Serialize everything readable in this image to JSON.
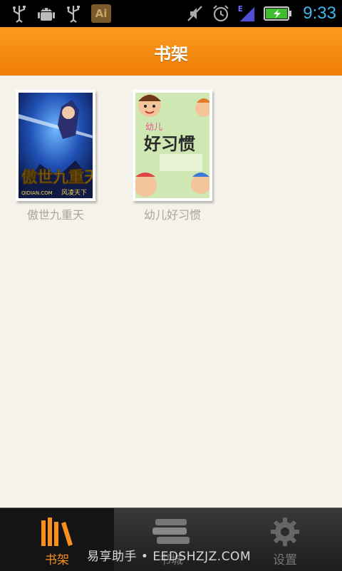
{
  "status_bar": {
    "icons_left": [
      "usb-icon",
      "android-debug-icon",
      "usb-icon",
      "ai-app-icon"
    ],
    "ai_badge": "Ai",
    "icons_right": [
      "mute-icon",
      "alarm-icon",
      "signal-e-icon",
      "battery-charging-icon"
    ],
    "network_type": "E",
    "time": "9:33"
  },
  "header": {
    "title": "书架"
  },
  "shelf": {
    "books": [
      {
        "title": "傲世九重天",
        "cover_text": "傲世九重天",
        "cover_subtext": "风凌天下",
        "cover_site": "QIDIAN.COM"
      },
      {
        "title": "幼儿好习惯",
        "cover_text": "好习惯",
        "cover_small": "幼儿"
      }
    ]
  },
  "tabs": [
    {
      "label": "书架",
      "icon": "bookshelf-icon",
      "active": true
    },
    {
      "label": "书城",
      "icon": "book-stack-icon",
      "active": false
    },
    {
      "label": "设置",
      "icon": "gear-icon",
      "active": false
    }
  ],
  "watermark": "易享助手 • EEDSHZJZ.COM",
  "colors": {
    "accent": "#f7901e",
    "status_time": "#3db8ee",
    "background": "#f5f2ea"
  }
}
